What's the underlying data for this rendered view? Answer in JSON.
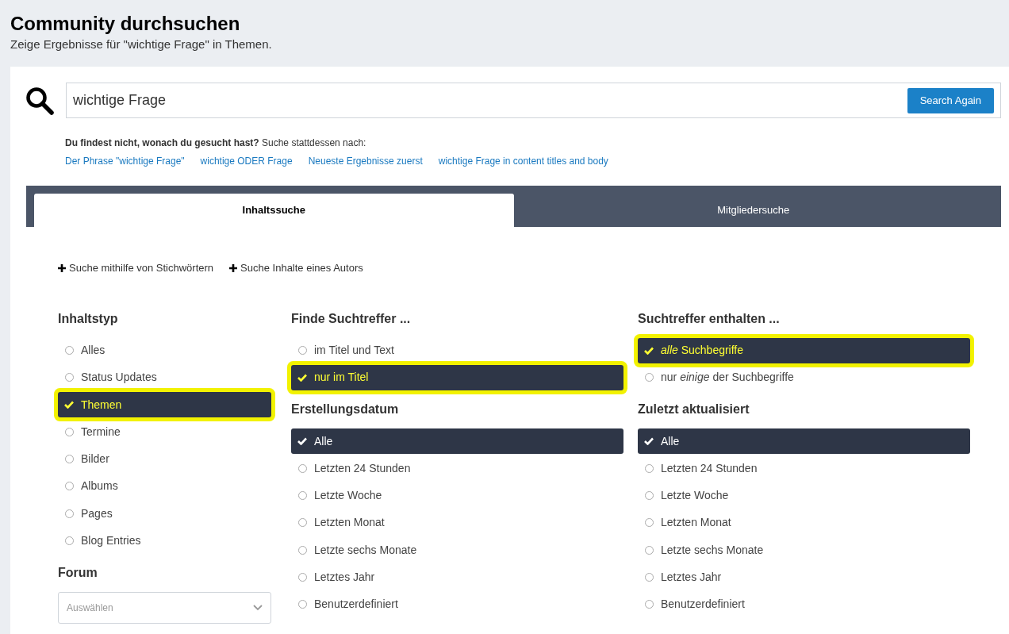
{
  "header": {
    "title": "Community durchsuchen",
    "subtitle": "Zeige Ergebnisse für \"wichtige Frage\" in Themen."
  },
  "search": {
    "value": "wichtige Frage",
    "button": "Search Again"
  },
  "suggestions": {
    "intro": "**Du findest nicht, wonach du gesucht hast?** Suche stattdessen nach:",
    "links": [
      "Der Phrase \"wichtige Frage\"",
      "wichtige ODER Frage",
      "Neueste Ergebnisse zuerst",
      "wichtige Frage in content titles and body"
    ]
  },
  "tabs": [
    {
      "label": "Inhaltssuche",
      "selected": true
    },
    {
      "label": "Mitgliedersuche",
      "selected": false
    }
  ],
  "toggles": [
    "Suche mithilfe von Stichwörtern",
    "Suche Inhalte eines Autors"
  ],
  "columns": [
    [
      {
        "title": "Inhaltstyp",
        "options": [
          {
            "label": "Alles",
            "selected": false,
            "highlighted": false
          },
          {
            "label": "Status Updates",
            "selected": false,
            "highlighted": false
          },
          {
            "label": "Themen",
            "selected": true,
            "highlighted": true
          },
          {
            "label": "Termine",
            "selected": false,
            "highlighted": false
          },
          {
            "label": "Bilder",
            "selected": false,
            "highlighted": false
          },
          {
            "label": "Albums",
            "selected": false,
            "highlighted": false
          },
          {
            "label": "Pages",
            "selected": false,
            "highlighted": false
          },
          {
            "label": "Blog Entries",
            "selected": false,
            "highlighted": false
          }
        ]
      },
      {
        "title": "Forum",
        "select_placeholder": "Auswählen"
      }
    ],
    [
      {
        "title": "Finde Suchtreffer ...",
        "options": [
          {
            "label": "im Titel und Text",
            "selected": false,
            "highlighted": false
          },
          {
            "label": "nur im Titel",
            "selected": true,
            "highlighted": true
          }
        ]
      },
      {
        "title": "Erstellungsdatum",
        "options": [
          {
            "label": "Alle",
            "selected": true,
            "highlighted": false
          },
          {
            "label": "Letzten 24 Stunden",
            "selected": false,
            "highlighted": false
          },
          {
            "label": "Letzte Woche",
            "selected": false,
            "highlighted": false
          },
          {
            "label": "Letzten Monat",
            "selected": false,
            "highlighted": false
          },
          {
            "label": "Letzte sechs Monate",
            "selected": false,
            "highlighted": false
          },
          {
            "label": "Letztes Jahr",
            "selected": false,
            "highlighted": false
          },
          {
            "label": "Benutzerdefiniert",
            "selected": false,
            "highlighted": false
          }
        ]
      }
    ],
    [
      {
        "title": "Suchtreffer enthalten ...",
        "options": [
          {
            "label": "*alle* Suchbegriffe",
            "selected": true,
            "highlighted": true
          },
          {
            "label": "nur *einige* der Suchbegriffe",
            "selected": false,
            "highlighted": false
          }
        ]
      },
      {
        "title": "Zuletzt aktualisiert",
        "options": [
          {
            "label": "Alle",
            "selected": true,
            "highlighted": false
          },
          {
            "label": "Letzten 24 Stunden",
            "selected": false,
            "highlighted": false
          },
          {
            "label": "Letzte Woche",
            "selected": false,
            "highlighted": false
          },
          {
            "label": "Letzten Monat",
            "selected": false,
            "highlighted": false
          },
          {
            "label": "Letzte sechs Monate",
            "selected": false,
            "highlighted": false
          },
          {
            "label": "Letztes Jahr",
            "selected": false,
            "highlighted": false
          },
          {
            "label": "Benutzerdefiniert",
            "selected": false,
            "highlighted": false
          }
        ]
      }
    ]
  ]
}
